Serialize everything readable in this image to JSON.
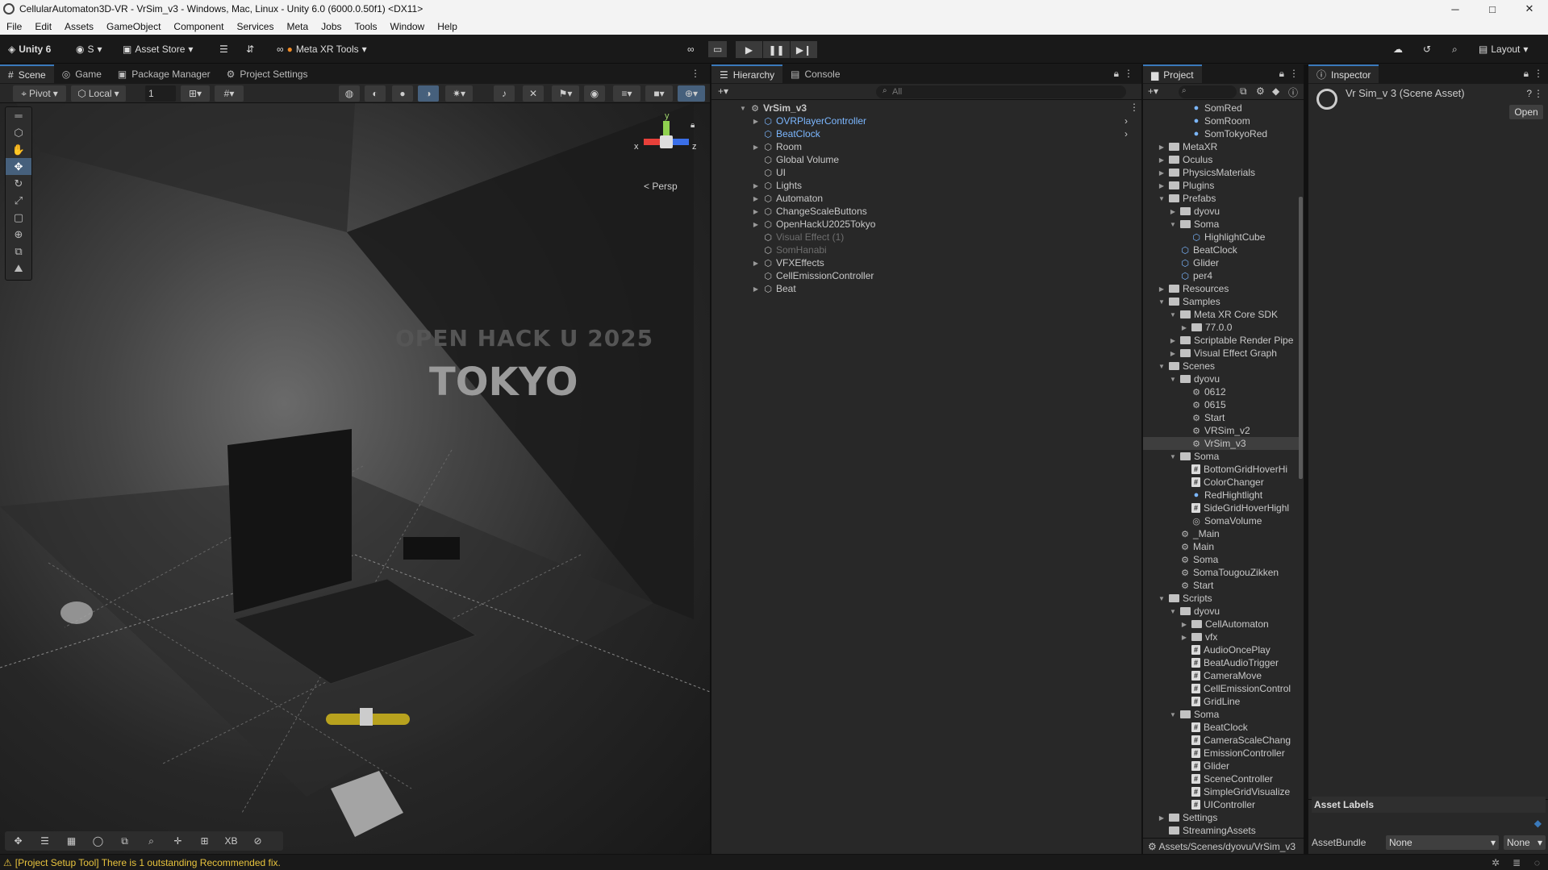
{
  "window": {
    "title": "CellularAutomaton3D-VR - VrSim_v3 - Windows, Mac, Linux - Unity 6.0 (6000.0.50f1) <DX11>",
    "minimize": "─",
    "maximize": "□",
    "close": "✕"
  },
  "menu": [
    "File",
    "Edit",
    "Assets",
    "GameObject",
    "Component",
    "Services",
    "Meta",
    "Jobs",
    "Tools",
    "Window",
    "Help"
  ],
  "toolbar": {
    "unity_label": "Unity 6",
    "account": "S",
    "asset_store": "Asset Store",
    "meta_tools": "Meta XR Tools",
    "layout": "Layout"
  },
  "left_tabs": [
    "Scene",
    "Game",
    "Package Manager",
    "Project Settings"
  ],
  "scene": {
    "pivot": "Pivot",
    "local": "Local",
    "snap_value": "1",
    "persp": "< Persp",
    "axis_x": "x",
    "axis_y": "y",
    "axis_z": "z",
    "wall_line1": "OPEN HACK U 2025",
    "wall_line2": "TOKYO"
  },
  "bottom_tools": [
    "✥",
    "☰",
    "▦",
    "◯",
    "⧉",
    "⌕",
    "✛",
    "⊞",
    "XB",
    "⊘"
  ],
  "hierarchy": {
    "tab": "Hierarchy",
    "console_tab": "Console",
    "search_placeholder": "All",
    "root": "VrSim_v3",
    "items": [
      {
        "label": "OVRPlayerController",
        "prefab": true,
        "arrow": true
      },
      {
        "label": "BeatClock",
        "prefab": true,
        "arrow": false
      },
      {
        "label": "Room",
        "prefab": false,
        "arrow": true
      },
      {
        "label": "Global Volume",
        "prefab": false,
        "arrow": false
      },
      {
        "label": "UI",
        "prefab": false,
        "arrow": false
      },
      {
        "label": "Lights",
        "prefab": false,
        "arrow": true
      },
      {
        "label": "Automaton",
        "prefab": false,
        "arrow": true
      },
      {
        "label": "ChangeScaleButtons",
        "prefab": false,
        "arrow": true
      },
      {
        "label": "OpenHackU2025Tokyo",
        "prefab": false,
        "arrow": true
      },
      {
        "label": "Visual Effect (1)",
        "prefab": false,
        "arrow": false,
        "dim": true
      },
      {
        "label": "SomHanabi",
        "prefab": false,
        "arrow": false,
        "dim": true
      },
      {
        "label": "VFXEffects",
        "prefab": false,
        "arrow": true
      },
      {
        "label": "CellEmissionController",
        "prefab": false,
        "arrow": false
      },
      {
        "label": "Beat",
        "prefab": false,
        "arrow": true
      }
    ]
  },
  "project": {
    "tab": "Project",
    "path": "Assets/Scenes/dyovu/VrSim_v3",
    "rows": [
      {
        "d": 3,
        "k": "mat",
        "t": "SomRed"
      },
      {
        "d": 3,
        "k": "mat",
        "t": "SomRoom"
      },
      {
        "d": 3,
        "k": "mat",
        "t": "SomTokyoRed"
      },
      {
        "d": 1,
        "k": "folder",
        "t": "MetaXR",
        "a": "▶"
      },
      {
        "d": 1,
        "k": "folder",
        "t": "Oculus",
        "a": "▶"
      },
      {
        "d": 1,
        "k": "folder",
        "t": "PhysicsMaterials",
        "a": "▶"
      },
      {
        "d": 1,
        "k": "folder",
        "t": "Plugins",
        "a": "▶"
      },
      {
        "d": 1,
        "k": "folder",
        "t": "Prefabs",
        "a": "▼"
      },
      {
        "d": 2,
        "k": "folder",
        "t": "dyovu",
        "a": "▶"
      },
      {
        "d": 2,
        "k": "folder",
        "t": "Soma",
        "a": "▼"
      },
      {
        "d": 3,
        "k": "prefab",
        "t": "HighlightCube"
      },
      {
        "d": 2,
        "k": "prefab",
        "t": "BeatClock"
      },
      {
        "d": 2,
        "k": "prefab",
        "t": "Glider"
      },
      {
        "d": 2,
        "k": "prefab",
        "t": "per4"
      },
      {
        "d": 1,
        "k": "folder",
        "t": "Resources",
        "a": "▶"
      },
      {
        "d": 1,
        "k": "folder",
        "t": "Samples",
        "a": "▼"
      },
      {
        "d": 2,
        "k": "folder",
        "t": "Meta XR Core SDK",
        "a": "▼"
      },
      {
        "d": 3,
        "k": "folder",
        "t": "77.0.0",
        "a": "▶"
      },
      {
        "d": 2,
        "k": "folder",
        "t": "Scriptable Render Pipe",
        "a": "▶"
      },
      {
        "d": 2,
        "k": "folder",
        "t": "Visual Effect Graph",
        "a": "▶"
      },
      {
        "d": 1,
        "k": "folder",
        "t": "Scenes",
        "a": "▼"
      },
      {
        "d": 2,
        "k": "folder",
        "t": "dyovu",
        "a": "▼"
      },
      {
        "d": 3,
        "k": "scene",
        "t": "0612"
      },
      {
        "d": 3,
        "k": "scene",
        "t": "0615"
      },
      {
        "d": 3,
        "k": "scene",
        "t": "Start"
      },
      {
        "d": 3,
        "k": "scene",
        "t": "VRSim_v2"
      },
      {
        "d": 3,
        "k": "scene",
        "t": "VrSim_v3",
        "sel": true
      },
      {
        "d": 2,
        "k": "folder",
        "t": "Soma",
        "a": "▼"
      },
      {
        "d": 3,
        "k": "script",
        "t": "BottomGridHoverHi"
      },
      {
        "d": 3,
        "k": "script",
        "t": "ColorChanger"
      },
      {
        "d": 3,
        "k": "mat",
        "t": "RedHightlight"
      },
      {
        "d": 3,
        "k": "script",
        "t": "SideGridHoverHighl"
      },
      {
        "d": 3,
        "k": "vol",
        "t": "SomaVolume"
      },
      {
        "d": 2,
        "k": "scene",
        "t": "_Main"
      },
      {
        "d": 2,
        "k": "scene",
        "t": "Main"
      },
      {
        "d": 2,
        "k": "scene",
        "t": "Soma"
      },
      {
        "d": 2,
        "k": "scene",
        "t": "SomaTougouZikken"
      },
      {
        "d": 2,
        "k": "scene",
        "t": "Start"
      },
      {
        "d": 1,
        "k": "folder",
        "t": "Scripts",
        "a": "▼"
      },
      {
        "d": 2,
        "k": "folder",
        "t": "dyovu",
        "a": "▼"
      },
      {
        "d": 3,
        "k": "folder",
        "t": "CellAutomaton",
        "a": "▶"
      },
      {
        "d": 3,
        "k": "folder",
        "t": "vfx",
        "a": "▶"
      },
      {
        "d": 3,
        "k": "script",
        "t": "AudioOncePlay"
      },
      {
        "d": 3,
        "k": "script",
        "t": "BeatAudioTrigger"
      },
      {
        "d": 3,
        "k": "script",
        "t": "CameraMove"
      },
      {
        "d": 3,
        "k": "script",
        "t": "CellEmissionControl"
      },
      {
        "d": 3,
        "k": "script",
        "t": "GridLine"
      },
      {
        "d": 2,
        "k": "folder",
        "t": "Soma",
        "a": "▼"
      },
      {
        "d": 3,
        "k": "script",
        "t": "BeatClock"
      },
      {
        "d": 3,
        "k": "script",
        "t": "CameraScaleChang"
      },
      {
        "d": 3,
        "k": "script",
        "t": "EmissionController"
      },
      {
        "d": 3,
        "k": "script",
        "t": "Glider"
      },
      {
        "d": 3,
        "k": "script",
        "t": "SceneController"
      },
      {
        "d": 3,
        "k": "script",
        "t": "SimpleGridVisualize"
      },
      {
        "d": 3,
        "k": "script",
        "t": "UIController"
      },
      {
        "d": 1,
        "k": "folder",
        "t": "Settings",
        "a": "▶"
      },
      {
        "d": 1,
        "k": "folder",
        "t": "StreamingAssets",
        "a": ""
      }
    ]
  },
  "inspector": {
    "tab": "Inspector",
    "asset_name": "Vr Sim_v 3 (Scene Asset)",
    "open_button": "Open",
    "asset_labels": "Asset Labels",
    "asset_bundle_label": "AssetBundle",
    "bundle_value": "None",
    "variant_value": "None"
  },
  "status": {
    "message": "[Project Setup Tool] There is 1 outstanding Recommended fix."
  },
  "colors": {
    "accent": "#3a79bb",
    "prefab_blue": "#7cb7ff",
    "warning": "#e8c33d"
  }
}
